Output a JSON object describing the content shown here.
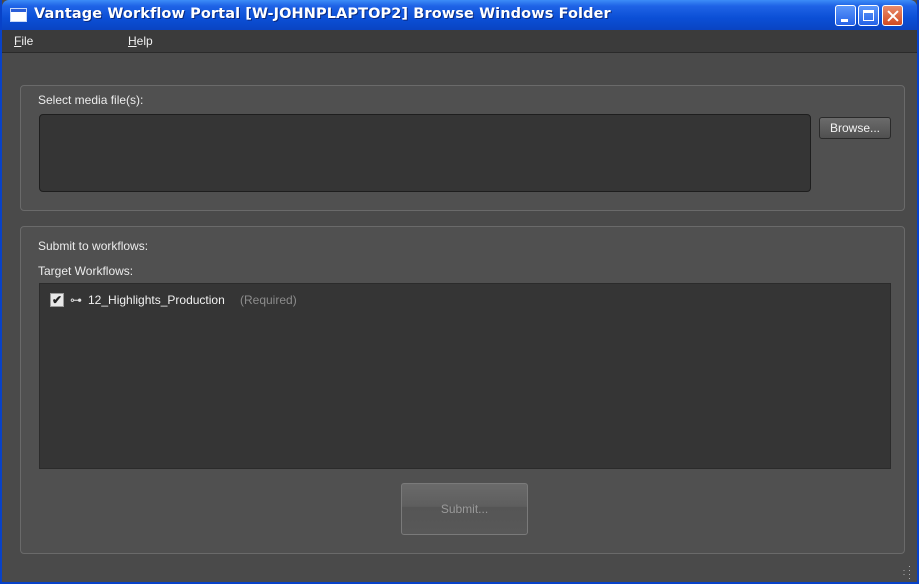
{
  "window": {
    "title": "Vantage Workflow Portal [W-JOHNPLAPTOP2]  Browse Windows Folder"
  },
  "menu": {
    "items": [
      {
        "first": "F",
        "rest": "ile"
      },
      {
        "first": "H",
        "rest": "elp"
      }
    ]
  },
  "media": {
    "label": "Select media file(s):",
    "browse_label": "Browse..."
  },
  "submit_section": {
    "label": "Submit to workflows:",
    "target_label": "Target Workflows:",
    "workflows": [
      {
        "name": "12_Highlights_Production",
        "note": "(Required)",
        "checked": true,
        "check_glyph": "✔",
        "icon": "workflow-icon"
      }
    ],
    "submit_label": "Submit..."
  },
  "colors": {
    "titlebar": "#0b4fd6",
    "window_bg": "#4a4a4a",
    "panel_bg": "#505050",
    "field_bg": "#353535"
  }
}
